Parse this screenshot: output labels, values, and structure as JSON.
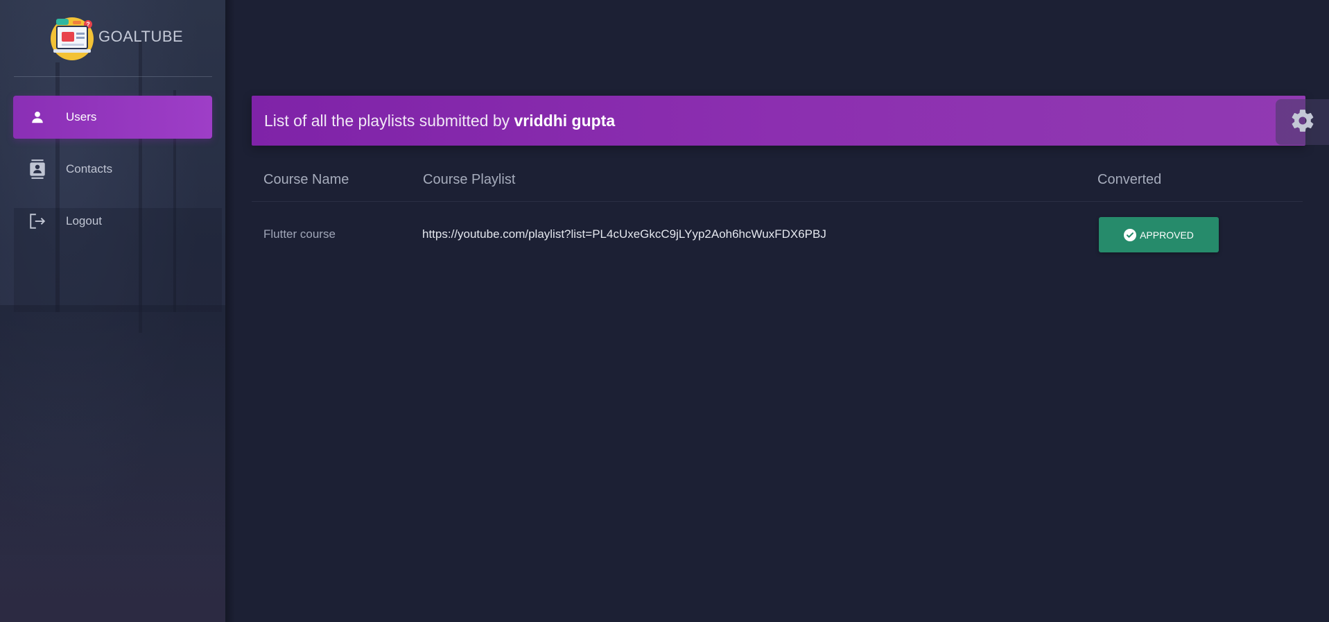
{
  "app": {
    "brand_name": "GOALTUBE"
  },
  "sidebar": {
    "items": [
      {
        "label": "Users",
        "icon": "person-icon",
        "active": true
      },
      {
        "label": "Contacts",
        "icon": "contacts-icon",
        "active": false
      },
      {
        "label": "Logout",
        "icon": "logout-icon",
        "active": false
      }
    ]
  },
  "header": {
    "title_prefix": "List of all the playlists submitted by ",
    "user_name": "vriddhi gupta"
  },
  "table": {
    "columns": [
      "Course Name",
      "Course Playlist",
      "Converted"
    ],
    "rows": [
      {
        "course_name": "Flutter course",
        "course_playlist": "https://youtube.com/playlist?list=PL4cUxeGkcC9jLYyp2Aoh6hcWuxFDX6PBJ",
        "status": "APPROVED"
      }
    ]
  },
  "colors": {
    "accent": "#8c2fb0",
    "approved": "#268b6b",
    "background": "#1c2034"
  }
}
